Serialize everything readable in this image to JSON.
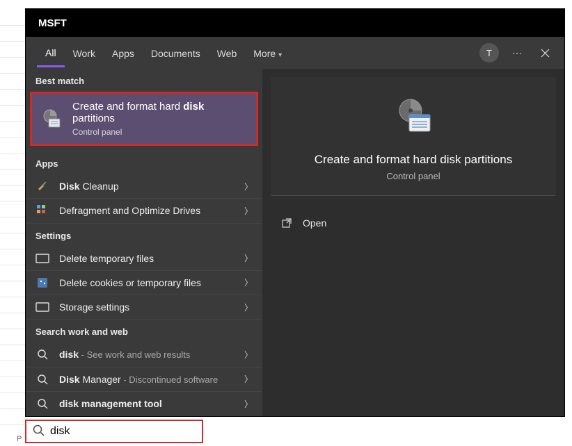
{
  "titlebar": {
    "title": "MSFT"
  },
  "tabs": {
    "items": [
      {
        "label": "All",
        "active": true
      },
      {
        "label": "Work"
      },
      {
        "label": "Apps"
      },
      {
        "label": "Documents"
      },
      {
        "label": "Web"
      },
      {
        "label": "More",
        "more": true
      }
    ],
    "avatar_initial": "T"
  },
  "sections": {
    "best_match_label": "Best match",
    "apps_label": "Apps",
    "settings_label": "Settings",
    "swaw_label": "Search work and web"
  },
  "best_match": {
    "title_head": "Create and format hard ",
    "title_bold": "disk",
    "title_tail": " partitions",
    "subtitle": "Control panel"
  },
  "apps": [
    {
      "icon": "broom-icon",
      "label_bold": "Disk",
      "label_tail": " Cleanup"
    },
    {
      "icon": "defrag-icon",
      "label_head": "Defragment and Optimize Drives"
    }
  ],
  "settings": [
    {
      "icon": "rect-icon",
      "label": "Delete temporary files"
    },
    {
      "icon": "cookie-icon",
      "label": "Delete cookies or temporary files"
    },
    {
      "icon": "rect-icon",
      "label": "Storage settings"
    }
  ],
  "swaw": [
    {
      "icon": "search-icon",
      "label_bold": "disk",
      "muted": " - See work and web results"
    },
    {
      "icon": "search-icon",
      "label_bold": "Disk",
      "label_tail": " Manager",
      "muted": " - Discontinued software"
    },
    {
      "icon": "search-icon",
      "label_bold": "disk",
      "label_tail": " ",
      "label_bold2": "management tool"
    }
  ],
  "detail": {
    "title": "Create and format hard disk partitions",
    "subtitle": "Control panel",
    "actions": [
      {
        "icon": "open-icon",
        "label": "Open"
      }
    ]
  },
  "search": {
    "value": "disk"
  },
  "bottom_letter": "P"
}
